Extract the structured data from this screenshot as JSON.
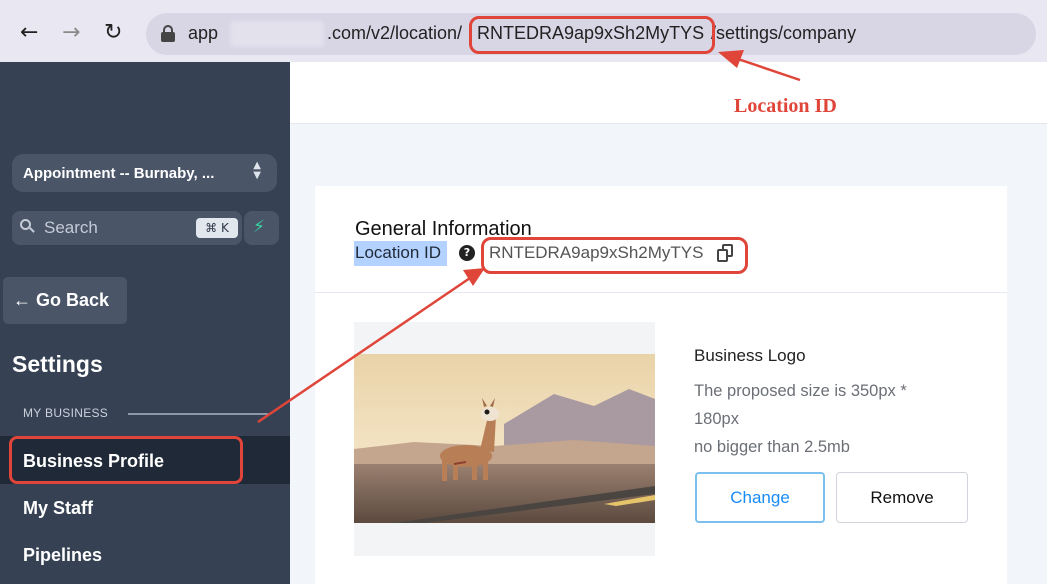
{
  "browser": {
    "back_icon": "arrow-left-icon",
    "forward_icon": "arrow-right-icon",
    "reload_icon": "reload-icon",
    "url_prefix": "app",
    "url_middle": ".com/v2/location/",
    "url_location_id": "RNTEDRA9ap9xSh2MyTYS",
    "url_suffix": "/settings/company"
  },
  "sidebar": {
    "location_select": "Appointment -- Burnaby, ...",
    "search_placeholder": "Search",
    "search_shortcut": "⌘ K",
    "go_back": "← Go Back",
    "title": "Settings",
    "section_label": "MY BUSINESS",
    "items": [
      {
        "label": "Business Profile",
        "active": true
      },
      {
        "label": "My Staff",
        "active": false
      },
      {
        "label": "Pipelines",
        "active": false
      }
    ]
  },
  "main": {
    "card_title": "General Information",
    "location_id_label": "Location ID",
    "location_id_value": "RNTEDRA9ap9xSh2MyTYS",
    "logo": {
      "heading": "Business Logo",
      "hint_lines": [
        "The proposed size is 350px *",
        "180px",
        "no bigger than 2.5mb"
      ],
      "change_label": "Change",
      "remove_label": "Remove"
    }
  },
  "annotation": {
    "label": "Location ID",
    "color": "#e0453a"
  },
  "colors": {
    "sidebar_bg": "#364153",
    "sidebar_active_bg": "#1f2937",
    "accent_blue": "#188bf6",
    "highlight_red": "#e0453a"
  }
}
